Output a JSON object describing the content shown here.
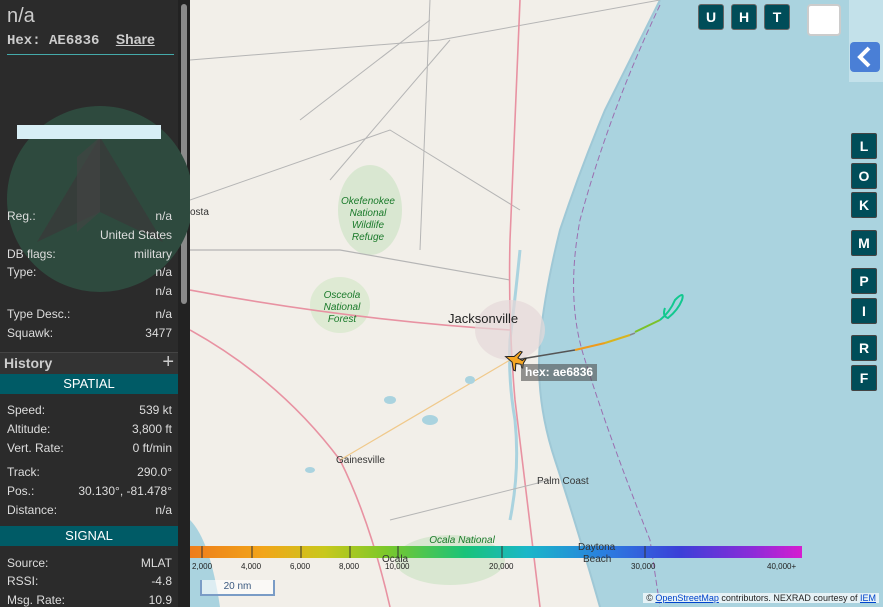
{
  "aircraft": {
    "callsign": "n/a",
    "hex_label": "Hex:",
    "hex": "AE6836",
    "share": "Share"
  },
  "info": {
    "reg_key": "Reg.:",
    "reg_val": "n/a",
    "country": "United States",
    "dbflags_key": "DB flags:",
    "dbflags_val": "military",
    "type_key": "Type:",
    "type_val": "n/a",
    "type_sub": "n/a",
    "typedesc_key": "Type Desc.:",
    "typedesc_val": "n/a",
    "squawk_key": "Squawk:",
    "squawk_val": "3477"
  },
  "history": {
    "title": "History",
    "plus": "+"
  },
  "spatial": {
    "title": "SPATIAL",
    "speed_key": "Speed:",
    "speed_val": "539 kt",
    "alt_key": "Altitude:",
    "alt_val": "3,800 ft",
    "vrate_key": "Vert. Rate:",
    "vrate_val": "0 ft/min",
    "track_key": "Track:",
    "track_val": "290.0°",
    "pos_key": "Pos.:",
    "pos_val": "30.130°, -81.478°",
    "dist_key": "Distance:",
    "dist_val": "n/a"
  },
  "signal": {
    "title": "SIGNAL",
    "source_key": "Source:",
    "source_val": "MLAT",
    "rssi_key": "RSSI:",
    "rssi_val": "-4.8",
    "msgrate_key": "Msg. Rate:",
    "msgrate_val": "10.9"
  },
  "toolbar": {
    "u": "U",
    "h": "H",
    "t": "T"
  },
  "side_buttons": {
    "l": "L",
    "o": "O",
    "k": "K",
    "m": "M",
    "p": "P",
    "i": "I",
    "r": "R",
    "f": "F"
  },
  "map_labels": {
    "jacksonville": "Jacksonville",
    "gainesville": "Gainesville",
    "palm_coast": "Palm Coast",
    "daytona": "Daytona",
    "beach": "Beach",
    "ocala": "Ocala",
    "valdosta_frag": "osta",
    "okefenokee": "Okefenokee",
    "national": "National",
    "wildlife": "Wildlife",
    "refuge": "Refuge",
    "osceola": "Osceola",
    "national2": "National",
    "forest": "Forest",
    "ocala_nf": "Ocala National"
  },
  "aircraft_label": "hex: ae6836",
  "altitude_scale": {
    "ticks": [
      "2,000",
      "4,000",
      "6,000",
      "8,000",
      "10,000",
      "20,000",
      "30,000",
      "40,000+"
    ]
  },
  "scale_bar": "20 nm",
  "attribution": {
    "copy": "©",
    "osm": "OpenStreetMap",
    "mid": "contributors. NEXRAD courtesy of",
    "iem": "IEM"
  },
  "colors": {
    "sidebar_bg": "#2b2b2b",
    "section_bg": "#005b66",
    "water": "#aad3df",
    "land": "#f2efe9",
    "button_bg": "#004d59"
  }
}
